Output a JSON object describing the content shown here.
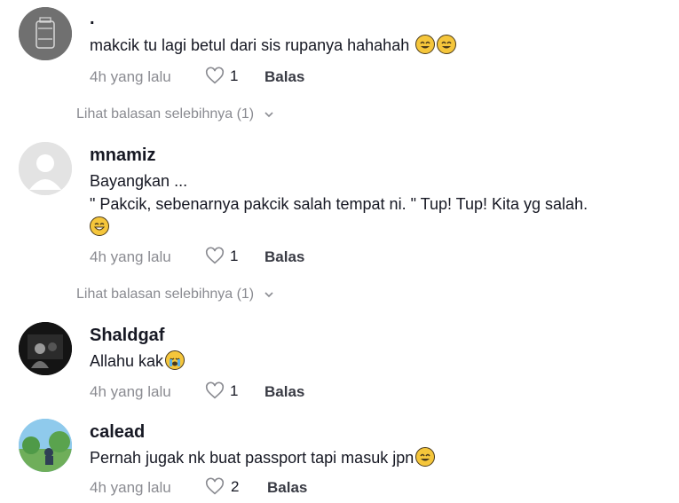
{
  "comments": [
    {
      "username": ".",
      "lines": [
        "makcik tu lagi betul dari sis rupanya hahahah"
      ],
      "emojis": [
        "rolling-laughing-emoji",
        "rolling-laughing-emoji"
      ],
      "time": "4h yang lalu",
      "likes": "1",
      "reply": "Balas",
      "more_replies": "Lihat balasan selebihnya (1)"
    },
    {
      "username": "mnamiz",
      "lines": [
        "Bayangkan ...",
        "\" Pakcik, sebenarnya pakcik salah tempat ni. \" Tup! Tup! Kita yg salah."
      ],
      "emojis": [
        "grinning-sweat-emoji"
      ],
      "time": "4h yang lalu",
      "likes": "1",
      "reply": "Balas",
      "more_replies": "Lihat balasan selebihnya (1)"
    },
    {
      "username": "Shaldgaf",
      "lines": [
        "Allahu kak"
      ],
      "emojis": [
        "loudly-crying-emoji"
      ],
      "time": "4h yang lalu",
      "likes": "1",
      "reply": "Balas"
    },
    {
      "username": "calead",
      "lines": [
        "Pernah jugak nk buat passport tapi masuk jpn"
      ],
      "emojis": [
        "rolling-laughing-emoji"
      ],
      "time": "4h yang lalu",
      "likes": "2",
      "reply": "Balas"
    }
  ],
  "colors": {
    "text": "#161823",
    "muted": "#8a8b91",
    "emoji": "#f5c63b"
  }
}
